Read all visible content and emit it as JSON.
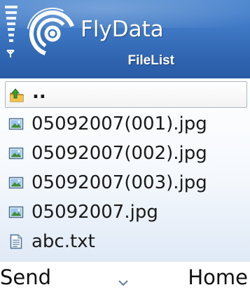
{
  "header": {
    "app_name": "FlyData",
    "screen_title": "FileList",
    "colors": {
      "background": "#3f79c5",
      "text": "#ffffff"
    }
  },
  "file_list": {
    "items": [
      {
        "label": "..",
        "icon": "folder-up-icon",
        "selected": true
      },
      {
        "label": "05092007(001).jpg",
        "icon": "image-file-icon",
        "selected": false
      },
      {
        "label": "05092007(002).jpg",
        "icon": "image-file-icon",
        "selected": false
      },
      {
        "label": "05092007(003).jpg",
        "icon": "image-file-icon",
        "selected": false
      },
      {
        "label": "05092007.jpg",
        "icon": "image-file-icon",
        "selected": false
      },
      {
        "label": "abc.txt",
        "icon": "text-file-icon",
        "selected": false
      }
    ]
  },
  "softkeys": {
    "left": "Send",
    "middle_icon": "chevron-down-icon",
    "right": "Home"
  }
}
